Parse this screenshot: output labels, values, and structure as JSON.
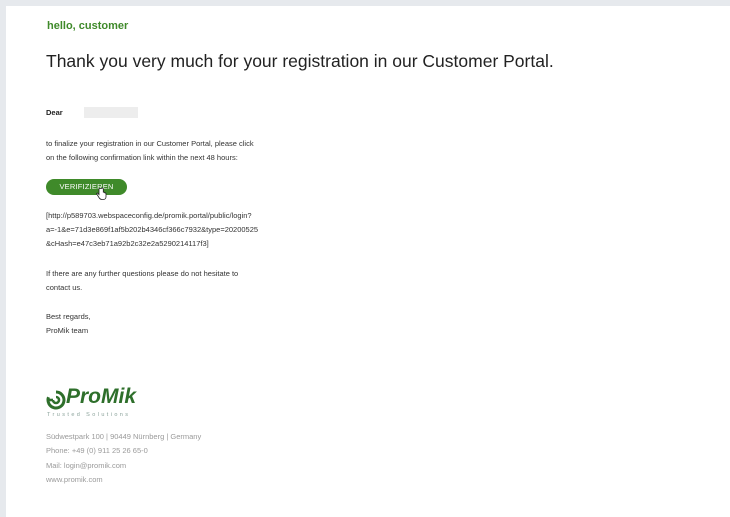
{
  "email": {
    "greeting": "hello, customer",
    "headline": "Thank you very much for your registration in our Customer Portal.",
    "salutation": "Dear",
    "intro_line1": "to finalize your registration in our Customer Portal, please click",
    "intro_line2": "on the following confirmation link within the next 48 hours:",
    "verify_button": "VERIFIZIEREN",
    "link_line1": "[http://p589703.webspaceconfig.de/promik.portal/public/login?",
    "link_line2": "a=-1&e=71d3e869f1af5b202b4346cf366c7932&type=20200525",
    "link_line3": "&cHash=e47c3eb71a92b2c32e2a5290214117f3]",
    "questions_line1": "If there are any further questions please do not hesitate to",
    "questions_line2": "contact us.",
    "regards_line1": "Best regards,",
    "regards_line2": "ProMik team"
  },
  "logo": {
    "word": "ProMik",
    "tagline": "Trusted Solutions",
    "brand_color": "#2e6f2b"
  },
  "footer": {
    "address": "Südwestpark 100 | 90449 Nürnberg | Germany",
    "phone": "Phone: +49 (0) 911 25 26 65-0",
    "mail": "Mail: login@promik.com",
    "web": "www.promik.com"
  },
  "colors": {
    "accent": "#3f8a2a",
    "background": "#e6e9ed"
  }
}
